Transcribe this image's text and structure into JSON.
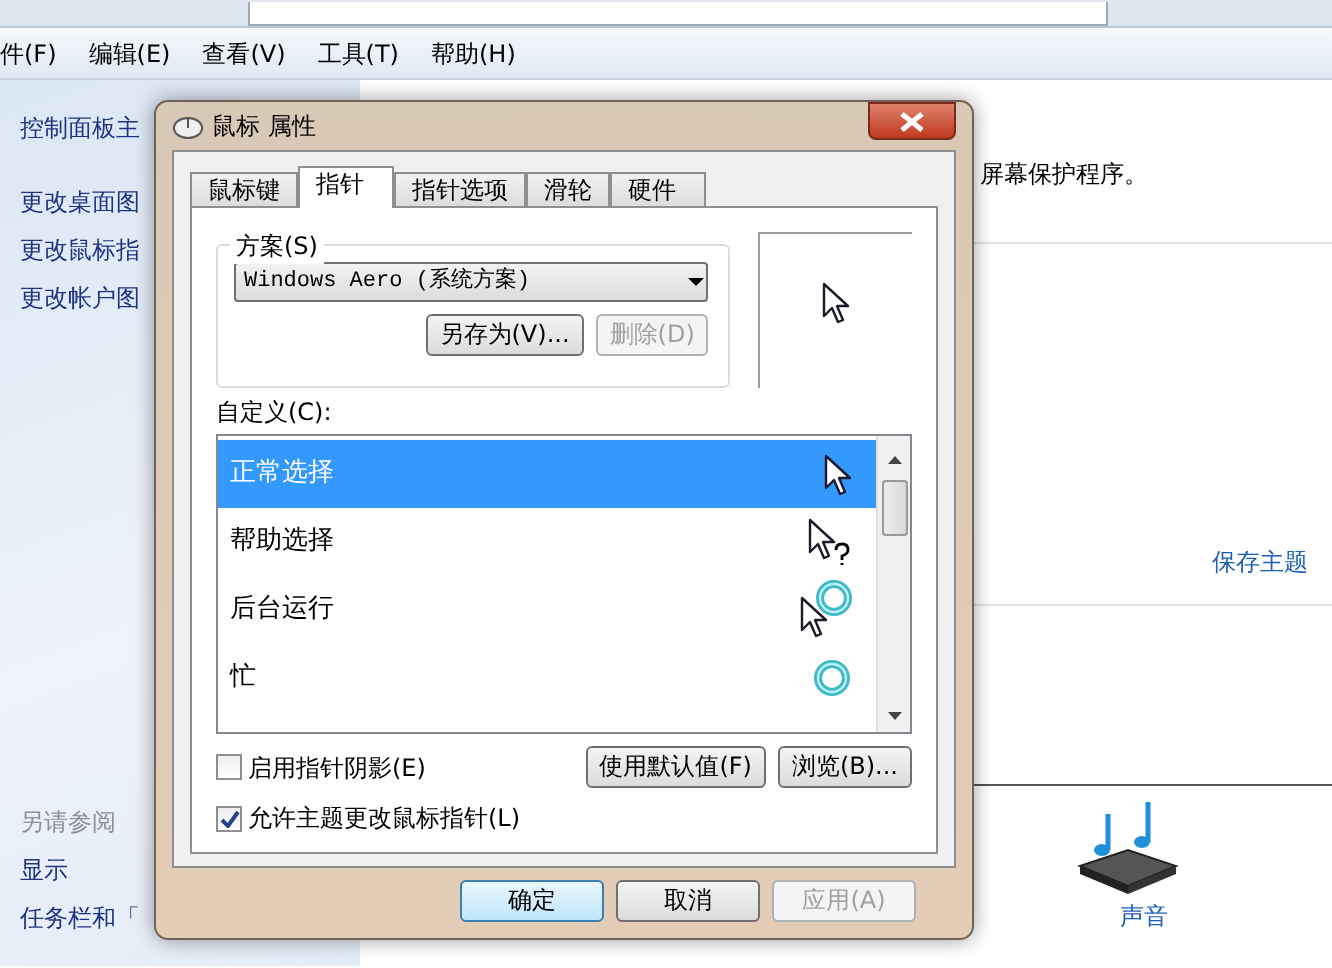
{
  "menu": [
    "件(F)",
    "编辑(E)",
    "查看(V)",
    "工具(T)",
    "帮助(H)"
  ],
  "sidebar": {
    "links": [
      "控制面板主",
      "更改桌面图",
      "更改鼠标指",
      "更改帐户图"
    ],
    "see_also": {
      "heading": "另请参阅",
      "links": [
        "显示",
        "任务栏和「"
      ]
    }
  },
  "content": {
    "screensaver_text": "屏幕保护程序。",
    "save_theme": "保存主题",
    "sound": "声音"
  },
  "dialog": {
    "title": "鼠标 属性",
    "tabs": [
      {
        "label": "鼠标键",
        "selected": false
      },
      {
        "label": "指针",
        "selected": true
      },
      {
        "label": "指针选项",
        "selected": false
      },
      {
        "label": "滑轮",
        "selected": false
      },
      {
        "label": "硬件",
        "selected": false
      }
    ],
    "scheme": {
      "legend": "方案(S)",
      "value": "Windows Aero (系统方案)",
      "buttons": [
        {
          "label": "另存为(V)...",
          "disabled": false
        },
        {
          "label": "删除(D)",
          "disabled": true
        }
      ]
    },
    "customize": {
      "label": "自定义(C):",
      "items": [
        {
          "label": "正常选择",
          "kind": "arrow",
          "selected": true
        },
        {
          "label": "帮助选择",
          "kind": "help",
          "selected": false
        },
        {
          "label": "后台运行",
          "kind": "working",
          "selected": false
        },
        {
          "label": "忙",
          "kind": "busy",
          "selected": false
        }
      ]
    },
    "options": [
      {
        "label": "启用指针阴影(E)",
        "checked": false
      },
      {
        "label": "允许主题更改鼠标指针(L)",
        "checked": true
      }
    ],
    "side_buttons": [
      "使用默认值(F)",
      "浏览(B)..."
    ],
    "footer_buttons": [
      {
        "label": "确定",
        "default": true,
        "disabled": false
      },
      {
        "label": "取消",
        "default": false,
        "disabled": false
      },
      {
        "label": "应用(A)",
        "default": false,
        "disabled": true
      }
    ]
  }
}
